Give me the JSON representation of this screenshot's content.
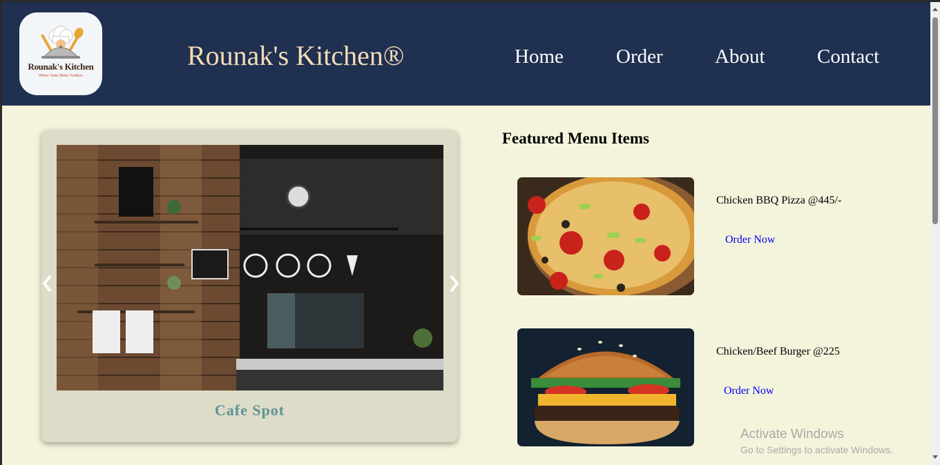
{
  "header": {
    "logo": {
      "title": "Rounak's Kitchen",
      "tagline": "Where Taste Meets Tradition"
    },
    "site_title": "Rounak's Kitchen®",
    "nav": [
      "Home",
      "Order",
      "About",
      "Contact"
    ]
  },
  "carousel": {
    "caption": "Cafe Spot",
    "prev_icon": "chevron-left-icon",
    "next_icon": "chevron-right-icon"
  },
  "featured": {
    "title": "Featured Menu Items",
    "items": [
      {
        "name": "Chicken BBQ Pizza @445/-",
        "order_label": "Order Now"
      },
      {
        "name": "Chicken/Beef Burger @225",
        "order_label": "Order Now"
      }
    ]
  },
  "watermark": {
    "title": "Activate Windows",
    "subtitle": "Go to Settings to activate Windows."
  },
  "colors": {
    "header_bg": "#1f3050",
    "page_bg": "#f4f4dd",
    "title_color": "#f6dcb6",
    "card_bg": "#dcdcc8",
    "caption_color": "#5e9396",
    "link_color": "#0000ee"
  }
}
